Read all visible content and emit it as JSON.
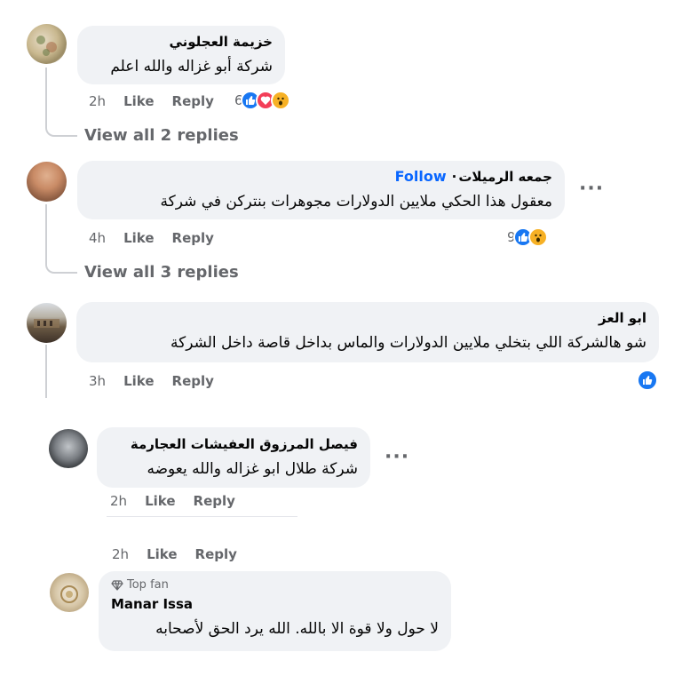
{
  "comments": [
    {
      "author": "خزيمة العجلوني",
      "text": "شركة أبو غزاله والله اعلم",
      "age": "2h",
      "like_label": "Like",
      "reply_label": "Reply",
      "reaction_count": "6",
      "reactions": [
        "like",
        "love",
        "wow"
      ],
      "view_replies": "View all 2 replies"
    },
    {
      "author": "جمعه الرميلات",
      "follow_label": "Follow",
      "text": "معقول هذا الحكي ملايين الدولارات مجوهرات بنتركن في شركة",
      "age": "4h",
      "like_label": "Like",
      "reply_label": "Reply",
      "reaction_count": "9",
      "reactions": [
        "like",
        "wow"
      ],
      "view_replies": "View all 3 replies"
    },
    {
      "author": "ابو العز",
      "text": "شو هالشركة اللي بتخلي ملايين الدولارات والماس بداخل قاصة داخل الشركة",
      "age": "3h",
      "like_label": "Like",
      "reply_label": "Reply",
      "reactions": [
        "like"
      ]
    }
  ],
  "replies": [
    {
      "author": "فيصل المرزوق العفيشات العجارمة",
      "text": "شركة طلال ابو غزاله والله يعوضه",
      "age": "2h",
      "like_label": "Like",
      "reply_label": "Reply"
    },
    {
      "badge": "Top fan",
      "author": "Manar Issa",
      "text": "لا حول ولا قوة الا بالله. الله يرد الحق لأصحابه",
      "age": "2h",
      "like_label": "Like",
      "reply_label": "Reply"
    }
  ],
  "colors": {
    "bubble": "#f0f2f5",
    "meta": "#65676b",
    "accent": "#0866ff",
    "like": "#1877f2",
    "love": "#f33e58",
    "wow": "#f7b125"
  },
  "icons": [
    "like-reaction-icon",
    "love-reaction-icon",
    "wow-reaction-icon",
    "more-options-icon",
    "diamond-icon"
  ]
}
